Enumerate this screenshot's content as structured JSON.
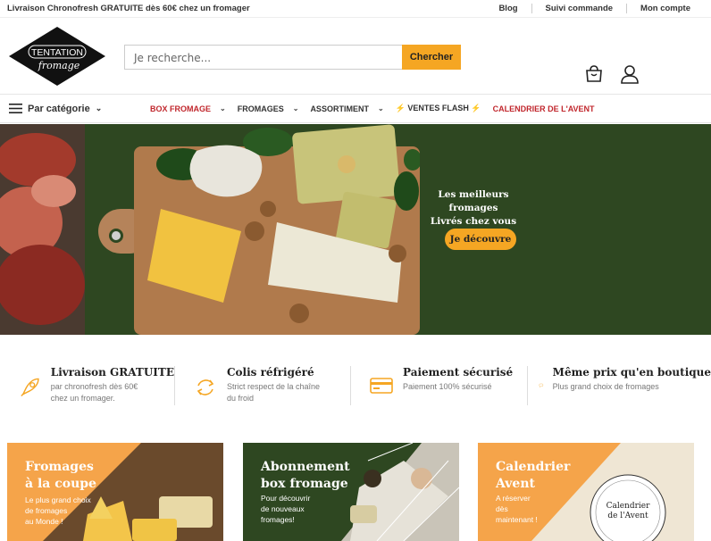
{
  "topbar": {
    "promo": "Livraison Chronofresh GRATUITE dès 60€ chez un fromager",
    "links": [
      "Blog",
      "Suivi commande",
      "Mon compte"
    ]
  },
  "header": {
    "logo_line1": "TENTATION",
    "logo_line2": "fromage",
    "search_placeholder": "Je recherche...",
    "search_button": "Chercher"
  },
  "nav": {
    "category": "Par catégorie",
    "items": [
      "BOX FROMAGE",
      "FROMAGES",
      "ASSORTIMENT",
      "⚡ VENTES FLASH ⚡",
      "CALENDRIER DE L'AVENT"
    ]
  },
  "hero": {
    "line1": "Les meilleurs fromages",
    "line2": "Livrés chez vous !",
    "cta": "Je découvre"
  },
  "features": [
    {
      "title": "Livraison GRATUITE",
      "desc1": "par chronofresh dès 60€",
      "desc2": "chez un fromager.",
      "icon": "rocket-icon"
    },
    {
      "title": "Colis réfrigéré",
      "desc1": "Strict respect de la chaîne",
      "desc2": "du froid",
      "icon": "refresh-icon"
    },
    {
      "title": "Paiement sécurisé",
      "desc1": "Paiement 100% sécurisé",
      "desc2": "",
      "icon": "credit-card-icon"
    },
    {
      "title": "Même prix qu'en boutique",
      "desc1": "Plus grand choix de fromages",
      "desc2": "",
      "icon": "chat-icon"
    }
  ],
  "cards": [
    {
      "title1": "Fromages",
      "title2": "à la coupe",
      "d1": "Le plus grand choix",
      "d2": "de fromages",
      "d3": "au Monde !"
    },
    {
      "title1": "Abonnement",
      "title2": "box fromage",
      "d1": "Pour découvrir",
      "d2": "de nouveaux",
      "d3": "fromages!"
    },
    {
      "title1": "Calendrier",
      "title2": "Avent",
      "d1": "A réserver",
      "d2": "dès",
      "d3": "maintenant !",
      "badge1": "Calendrier",
      "badge2": "de l'Avent"
    }
  ],
  "colors": {
    "accent": "#f5a623",
    "green": "#2e4721",
    "red": "#c1272d"
  }
}
